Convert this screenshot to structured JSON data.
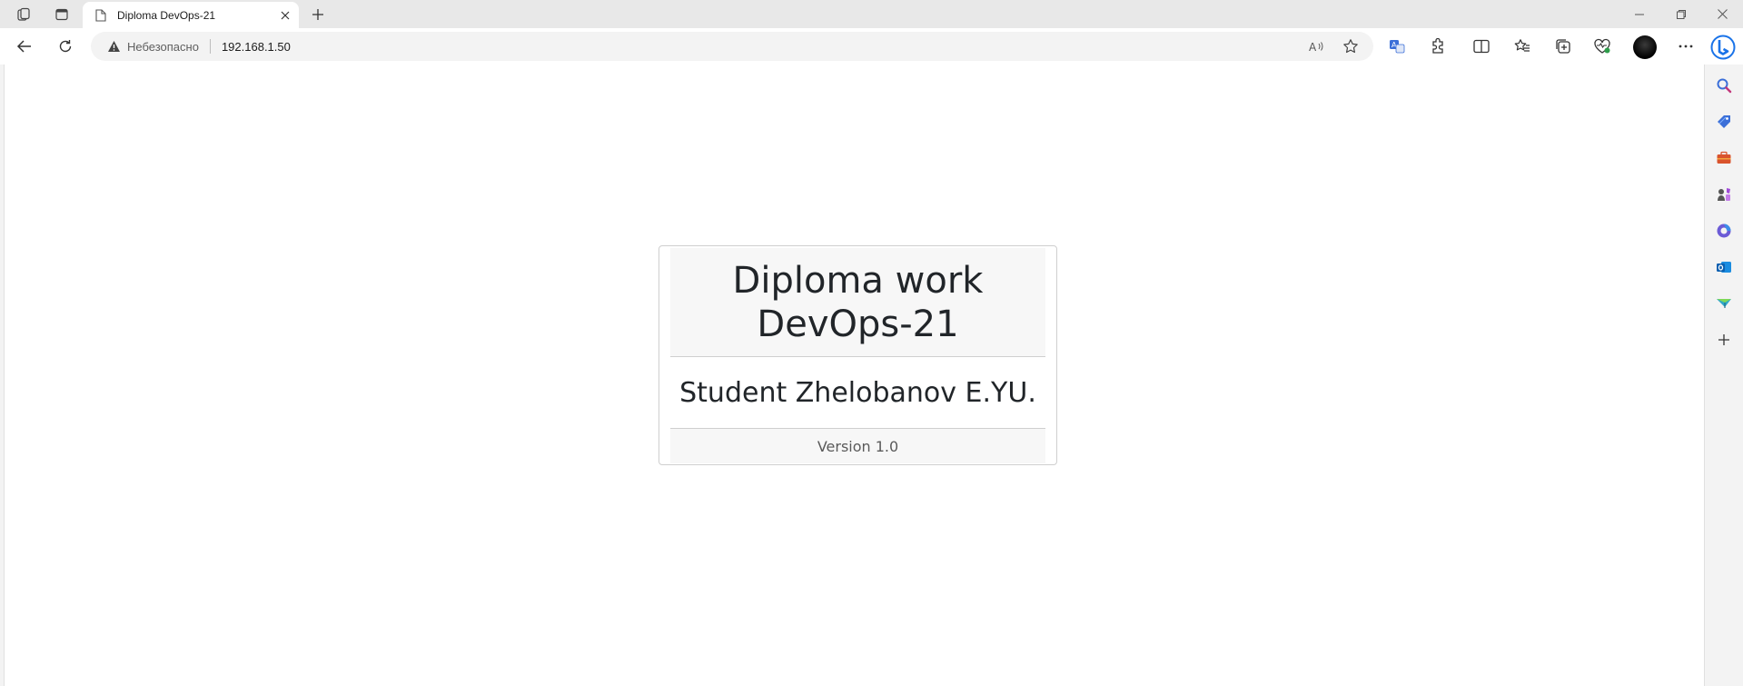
{
  "tab": {
    "title": "Diploma DevOps-21"
  },
  "address": {
    "security_label": "Небезопасно",
    "url": "192.168.1.50"
  },
  "page": {
    "heading_line1": "Diploma work",
    "heading_line2": "DevOps-21",
    "student": "Student Zhelobanov E.YU.",
    "version": "Version 1.0"
  },
  "colors": {
    "card_border": "#cfcfcf",
    "card_header_bg": "#f7f7f7",
    "text": "#212529"
  },
  "icons": {
    "tab_strip": [
      "workspaces-icon",
      "tab-actions-icon"
    ],
    "toolbar": [
      "back-icon",
      "refresh-icon",
      "read-aloud-icon",
      "favorite-star-icon",
      "translate-icon",
      "extensions-icon",
      "split-screen-icon",
      "favorites-icon",
      "collections-icon",
      "browser-essentials-icon",
      "more-icon"
    ],
    "sidebar": [
      "search-icon",
      "shopping-icon",
      "tools-icon",
      "games-icon",
      "office-icon",
      "outlook-icon",
      "drop-icon",
      "add-icon"
    ]
  }
}
